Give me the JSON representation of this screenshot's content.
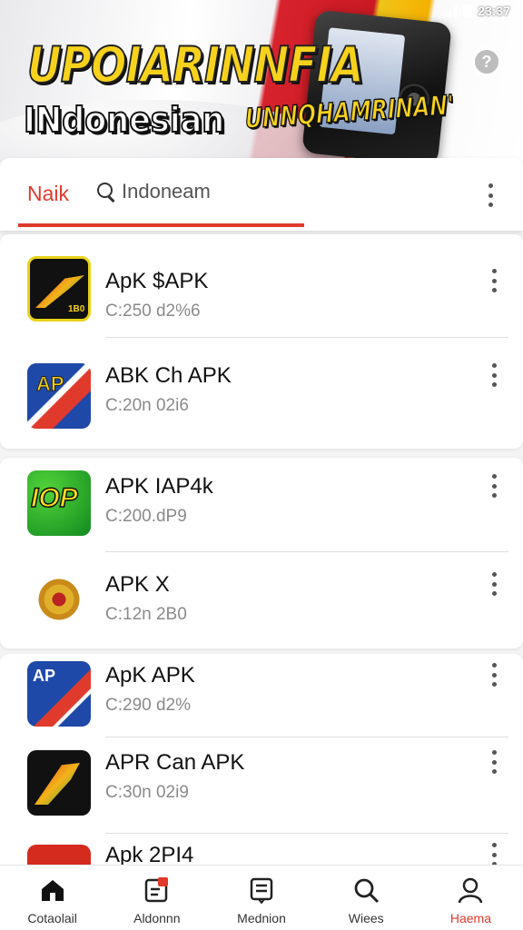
{
  "status_bar": {
    "time": "23:37"
  },
  "banner": {
    "title": "UPOIARINNFIA",
    "subtitle_1": "INdonesian",
    "subtitle_2": "UNNQHAMRINAN'",
    "info_icon": "info-icon"
  },
  "tabs": {
    "active_label": "Naik",
    "search_text": "Indoneam"
  },
  "apps": [
    {
      "name": "ApK $APK",
      "meta": "C:250 d2%6",
      "icon_text": "1B0"
    },
    {
      "name": "ABK Ch APK",
      "meta": "C:20n 02i6",
      "icon_text": "AP"
    },
    {
      "name": "APK IAP4k",
      "meta": "C:200.dP9",
      "icon_text": "IOP"
    },
    {
      "name": "APK X",
      "meta": "C:12n 2B0",
      "icon_text": ""
    },
    {
      "name": "ApK APK",
      "meta": "C:290 d2%",
      "icon_text": "AP"
    },
    {
      "name": "APR Can APK",
      "meta": "C:30n 02i9",
      "icon_text": ""
    },
    {
      "name": "Apk 2PI4",
      "meta": "",
      "icon_text": ""
    }
  ],
  "bottom_nav": [
    {
      "label": "Cotaolail",
      "icon": "home-icon"
    },
    {
      "label": "Aldonnn",
      "icon": "notification-icon"
    },
    {
      "label": "Mednion",
      "icon": "document-icon"
    },
    {
      "label": "Wiees",
      "icon": "search-icon"
    },
    {
      "label": "Haema",
      "icon": "profile-icon"
    }
  ],
  "colors": {
    "accent": "#e03a2d"
  }
}
